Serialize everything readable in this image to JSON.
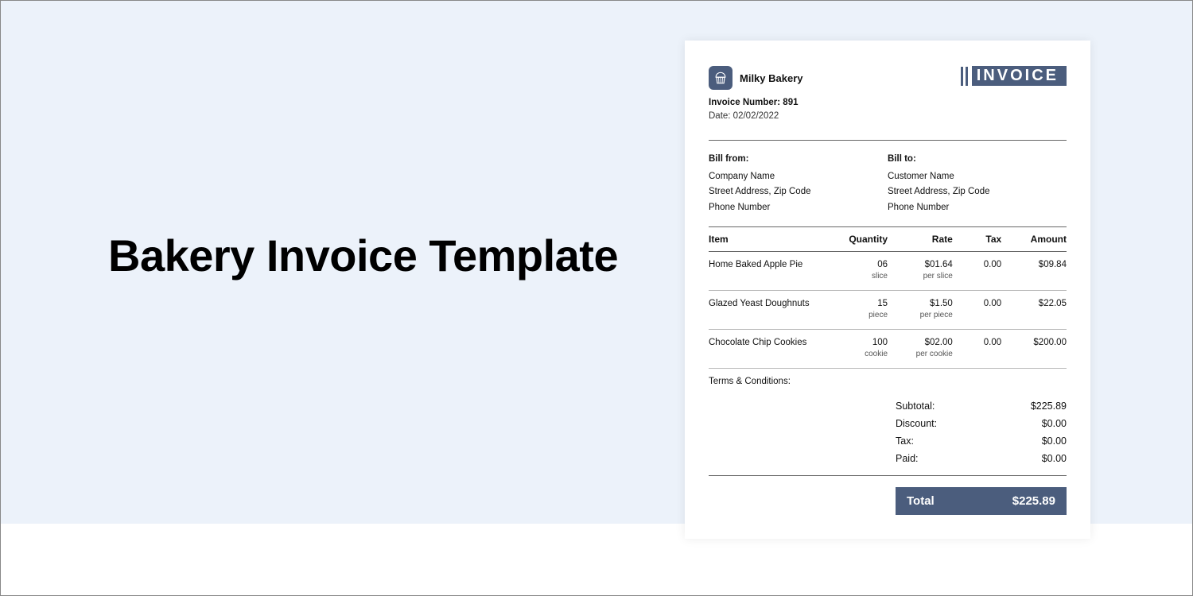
{
  "title": "Bakery Invoice Template",
  "invoice": {
    "brand_name": "Milky Bakery",
    "badge": "INVOICE",
    "invoice_number_label": "Invoice Number: 891",
    "date_label": "Date: 02/02/2022",
    "bill_from": {
      "hd": "Bill from:",
      "company": "Company Name",
      "address": "Street Address, Zip Code",
      "phone": "Phone Number"
    },
    "bill_to": {
      "hd": "Bill to:",
      "customer": "Customer Name",
      "address": "Street Address, Zip Code",
      "phone": "Phone Number"
    },
    "headers": {
      "item": "Item",
      "qty": "Quantity",
      "rate": "Rate",
      "tax": "Tax",
      "amount": "Amount"
    },
    "rows": [
      {
        "item": "Home Baked Apple Pie",
        "qty": "06",
        "qty_unit": "slice",
        "rate": "$01.64",
        "rate_unit": "per slice",
        "tax": "0.00",
        "amount": "$09.84"
      },
      {
        "item": "Glazed Yeast Doughnuts",
        "qty": "15",
        "qty_unit": "piece",
        "rate": "$1.50",
        "rate_unit": "per piece",
        "tax": "0.00",
        "amount": "$22.05"
      },
      {
        "item": "Chocolate Chip Cookies",
        "qty": "100",
        "qty_unit": "cookie",
        "rate": "$02.00",
        "rate_unit": "per cookie",
        "tax": "0.00",
        "amount": "$200.00"
      }
    ],
    "terms_label": "Terms & Conditions:",
    "totals": {
      "subtotal_label": "Subtotal:",
      "subtotal": "$225.89",
      "discount_label": "Discount:",
      "discount": "$0.00",
      "tax_label": "Tax:",
      "tax": "$0.00",
      "paid_label": "Paid:",
      "paid": "$0.00",
      "grand_label": "Total",
      "grand": "$225.89"
    }
  }
}
